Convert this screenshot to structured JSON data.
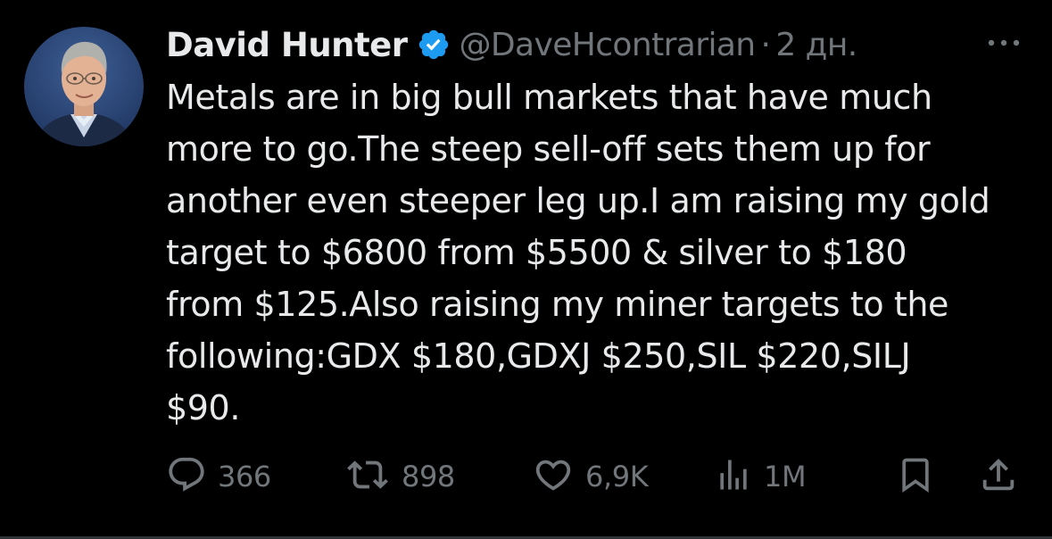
{
  "tweet": {
    "author": {
      "name": "David Hunter",
      "handle": "@DaveHcontrarian",
      "verified": true
    },
    "separator": "·",
    "time": "2 дн.",
    "text_lines": [
      "Metals are in big bull markets that have much",
      "more to go.The steep sell-off sets them up for",
      "another even steeper leg up.I am raising my gold",
      "target to $6800 from $5500 & silver to $180",
      "from $125.Also raising my miner targets to the",
      "following:GDX $180,GDXJ $250,SIL $220,SILJ",
      "$90."
    ],
    "stats": {
      "replies": "366",
      "reposts": "898",
      "likes": "6,9K",
      "views": "1M"
    }
  },
  "icons": {
    "more": "more-icon",
    "verified": "verified-badge-icon",
    "reply": "reply-icon",
    "repost": "repost-icon",
    "like": "like-icon",
    "views": "views-icon",
    "bookmark": "bookmark-icon",
    "share": "share-icon"
  },
  "colors": {
    "background": "#000000",
    "text": "#e7e9ea",
    "secondary": "#71767b",
    "verified": "#1d9bf0"
  }
}
